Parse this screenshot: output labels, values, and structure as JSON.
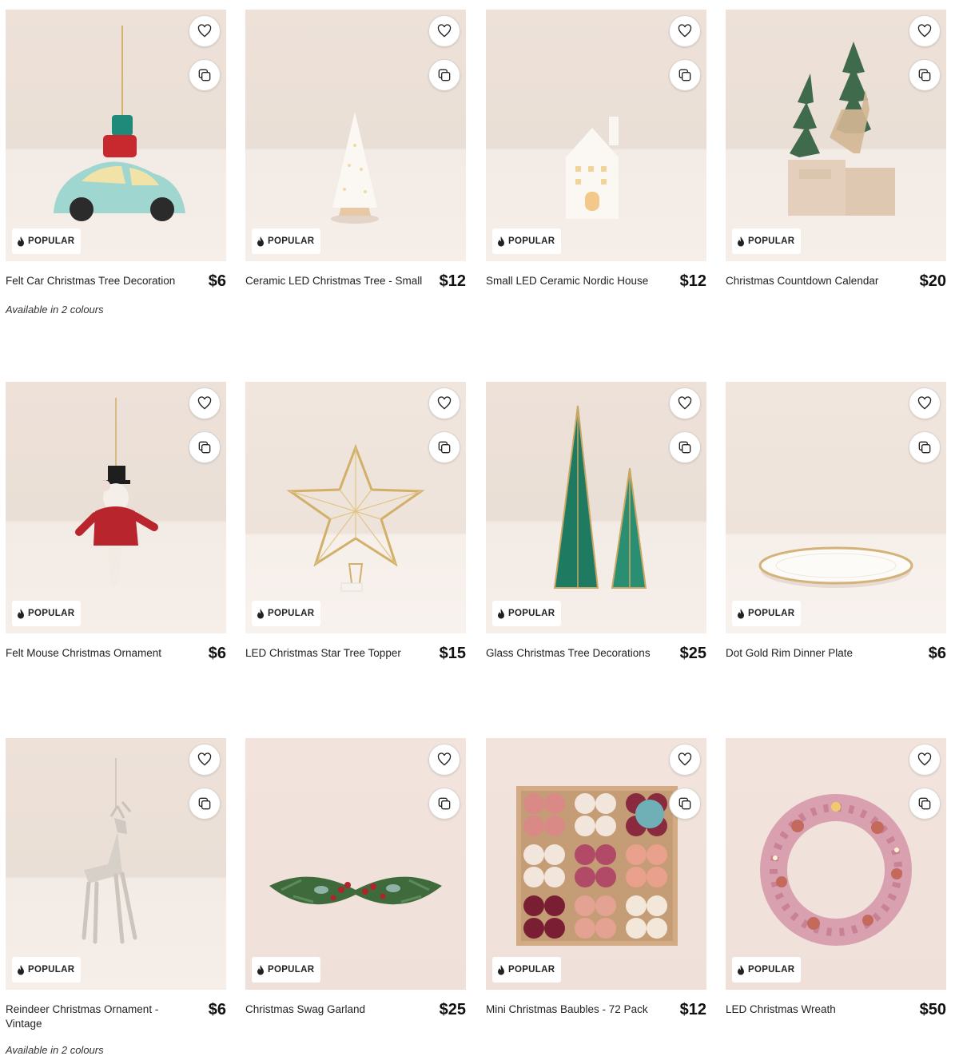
{
  "badge_label": "POPULAR",
  "icons": {
    "wishlist": "heart-icon",
    "compare": "compare-icon",
    "badge": "flame-icon"
  },
  "products": [
    {
      "name": "Felt Car Christmas Tree Decoration",
      "price": "$6",
      "colours": "Available in 2 colours"
    },
    {
      "name": "Ceramic LED Christmas Tree - Small",
      "price": "$12"
    },
    {
      "name": "Small LED Ceramic Nordic House",
      "price": "$12"
    },
    {
      "name": "Christmas Countdown Calendar",
      "price": "$20"
    },
    {
      "name": "Felt Mouse Christmas Ornament",
      "price": "$6"
    },
    {
      "name": "LED Christmas Star Tree Topper",
      "price": "$15"
    },
    {
      "name": "Glass Christmas Tree Decorations",
      "price": "$25"
    },
    {
      "name": "Dot Gold Rim Dinner Plate",
      "price": "$6"
    },
    {
      "name": "Reindeer Christmas Ornament - Vintage",
      "price": "$6",
      "colours": "Available in 2 colours"
    },
    {
      "name": "Christmas Swag Garland",
      "price": "$25"
    },
    {
      "name": "Mini Christmas Baubles - 72 Pack",
      "price": "$12"
    },
    {
      "name": "LED Christmas Wreath",
      "price": "$50"
    }
  ]
}
